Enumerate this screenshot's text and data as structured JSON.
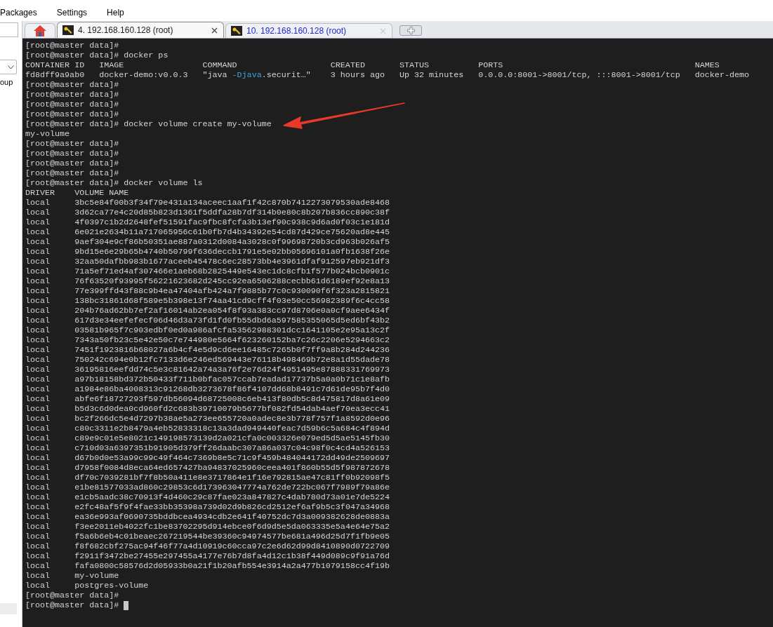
{
  "menu": [
    {
      "label": "Packages"
    },
    {
      "label": "Settings"
    },
    {
      "label": "Help"
    }
  ],
  "sidebar": {
    "partial_label": "oup"
  },
  "tabs": [
    {
      "kind": "home",
      "selected": false
    },
    {
      "kind": "session",
      "label": "4. 192.168.160.128 (root)",
      "selected": true
    },
    {
      "kind": "session",
      "label": "10. 192.168.160.128 (root)",
      "selected": false
    }
  ],
  "terminal": {
    "lines": [
      {
        "kind": "prompt",
        "prompt": "[root@master data]#",
        "cursor": false
      },
      {
        "kind": "prompt",
        "prompt": "[root@master data]#",
        "command": "docker ps",
        "cursor": false
      },
      {
        "kind": "ps",
        "cells": [
          [
            {
              "text": "CONTAINER ID"
            }
          ],
          [
            {
              "text": "IMAGE"
            }
          ],
          [
            {
              "text": "COMMAND"
            }
          ],
          [
            {
              "text": "CREATED"
            }
          ],
          [
            {
              "text": "STATUS"
            }
          ],
          [
            {
              "text": "PORTS"
            }
          ],
          [
            {
              "text": "NAMES"
            }
          ]
        ]
      },
      {
        "kind": "ps",
        "cells": [
          [
            {
              "text": "fd8dff9a9ab0"
            }
          ],
          [
            {
              "text": "docker-demo:v0.0.3"
            }
          ],
          [
            {
              "text": "\"java "
            },
            {
              "text": "-Djava",
              "color": "#3fa9d9"
            },
            {
              "text": ".securit…\""
            }
          ],
          [
            {
              "text": "3 hours ago"
            }
          ],
          [
            {
              "text": "Up 32 minutes"
            }
          ],
          [
            {
              "text": "0.0.0.0:8001->8001/tcp, :::8001->8001/tcp"
            }
          ],
          [
            {
              "text": "docker-demo"
            }
          ]
        ]
      },
      {
        "kind": "prompt",
        "prompt": "[root@master data]#",
        "cursor": false
      },
      {
        "kind": "prompt",
        "prompt": "[root@master data]#",
        "cursor": false
      },
      {
        "kind": "prompt",
        "prompt": "[root@master data]#",
        "cursor": false
      },
      {
        "kind": "prompt",
        "prompt": "[root@master data]#",
        "cursor": false
      },
      {
        "kind": "prompt",
        "prompt": "[root@master data]#",
        "command": "docker volume create my-volume",
        "cursor": false
      },
      {
        "kind": "output",
        "text": "my-volume"
      },
      {
        "kind": "prompt",
        "prompt": "[root@master data]#",
        "cursor": false
      },
      {
        "kind": "prompt",
        "prompt": "[root@master data]#",
        "cursor": false
      },
      {
        "kind": "prompt",
        "prompt": "[root@master data]#",
        "cursor": false
      },
      {
        "kind": "prompt",
        "prompt": "[root@master data]#",
        "cursor": false
      },
      {
        "kind": "prompt",
        "prompt": "[root@master data]#",
        "command": "docker volume ls",
        "cursor": false
      },
      {
        "kind": "volume",
        "driver": "DRIVER",
        "name": "VOLUME NAME"
      },
      {
        "kind": "volume",
        "driver": "local",
        "name": "3bc5e84f00b3f34f79e431a134aceec1aaf1f42c870b7412273079530ade8468"
      },
      {
        "kind": "volume",
        "driver": "local",
        "name": "3d62ca77e4c20d85b823d1361f5ddfa28b7df314b0e80c8b207b836cc890c38f"
      },
      {
        "kind": "volume",
        "driver": "local",
        "name": "4f0397c1b2d2648fef51591fac9fbc8fcfa3b13ef90c938c9d6ad0f03c1e181d"
      },
      {
        "kind": "volume",
        "driver": "local",
        "name": "6e021e2634b11a717065956c61b0fb7d4b34392e54cd87d429ce75620ad8e445"
      },
      {
        "kind": "volume",
        "driver": "local",
        "name": "9aef304e9cf86b50351ae887a0312d0084a3028c0f99698720b3cd963b026af5"
      },
      {
        "kind": "volume",
        "driver": "local",
        "name": "9bd15e6e29b65b4740b50799f636deccb1791e5e02bb05696101a0fb1638f26e"
      },
      {
        "kind": "volume",
        "driver": "local",
        "name": "32aa50dafbb983b1677aceeb45478c6ec28573bb4e3961dfaf912597eb921df3"
      },
      {
        "kind": "volume",
        "driver": "local",
        "name": "71a5ef71ed4af307466e1aeb68b2825449e543ec1dc8cfb1f577b024bcb0901c"
      },
      {
        "kind": "volume",
        "driver": "local",
        "name": "76f63520f93995f56221623682d245cc92ea6506288cecbb61d6189ef92e8a13"
      },
      {
        "kind": "volume",
        "driver": "local",
        "name": "77e399ffd43f88c9b4ea47404afb424a7f9885b77c0c930090f6f323a2815821"
      },
      {
        "kind": "volume",
        "driver": "local",
        "name": "138bc31861d68f589e5b398e13f74aa41cd9cff4f03e50cc56982389f6c4cc58"
      },
      {
        "kind": "volume",
        "driver": "local",
        "name": "204b76ad62bb7ef2af16014ab2ea054f8f93a383cc97d8706e0a0cf9aee6434f"
      },
      {
        "kind": "volume",
        "driver": "local",
        "name": "617d3e34eefefecf06d46d3a73fd1fd0fb55dbd6a597585355065d5ed6bf43b2"
      },
      {
        "kind": "volume",
        "driver": "local",
        "name": "03581b965f7c903edbf0ed0a986afcfa53562988301dcc1641105e2e95a13c2f"
      },
      {
        "kind": "volume",
        "driver": "local",
        "name": "7343a50fb23c5e42e50c7e744980e5664f623260152ba7c26c2206e5294663c2"
      },
      {
        "kind": "volume",
        "driver": "local",
        "name": "7451f1923816b68027a6b4cf4e5d9cd6ee16485c7265b0f7ff9a8b284d244236"
      },
      {
        "kind": "volume",
        "driver": "local",
        "name": "750242c694e0b12fc7133d6e246ed569443e76118b498469b72e8a1d55dade78"
      },
      {
        "kind": "volume",
        "driver": "local",
        "name": "36195816eefdd74c5e3c81642a74a3a76f2e76d24f4951495e87888331769973"
      },
      {
        "kind": "volume",
        "driver": "local",
        "name": "a97b18158bd372b50433f711b0bfac057ccab7eadad17737b5a0a0b71c1e8afb"
      },
      {
        "kind": "volume",
        "driver": "local",
        "name": "a1984e86ba4008313c91268db3273678f86f4107dd68b8491c7d61de95b7f4d0"
      },
      {
        "kind": "volume",
        "driver": "local",
        "name": "abfe6f18727293f597db56094d68725008c6eb413f80db5c8d475817d8a61e09"
      },
      {
        "kind": "volume",
        "driver": "local",
        "name": "b5d3c6d0dea0cd960fd2c683b39710079b5677bf082fd54dab4aef70ea3ecc41"
      },
      {
        "kind": "volume",
        "driver": "local",
        "name": "bc2f266dc5e4d7297b38ae5a273ee655720a0adec8e3b778f757f1a8592d0e96"
      },
      {
        "kind": "volume",
        "driver": "local",
        "name": "c80c3311e2b8479a4eb52833318c13a3dad949440feac7d59b6c5a684c4f894d"
      },
      {
        "kind": "volume",
        "driver": "local",
        "name": "c89e9c01e5e8021c149198573139d2a021cfa0c003326e079ed5d5ae5145fb30"
      },
      {
        "kind": "volume",
        "driver": "local",
        "name": "c710d03a6397351b91905d379ff26daabc307a86a037c04c98f0c4cd4a526153"
      },
      {
        "kind": "volume",
        "driver": "local",
        "name": "d67b0d0e53a99c99c49f464c7369b8e5c71c9f459b484044172dd49de2509697"
      },
      {
        "kind": "volume",
        "driver": "local",
        "name": "d7958f0084d8eca64ed657427ba94837025960ceea401f860b55d5f987872678"
      },
      {
        "kind": "volume",
        "driver": "local",
        "name": "df70c7039281bf7f8b50a411e8e3717864e1f16e792815ae47c81ff0b92098f5"
      },
      {
        "kind": "volume",
        "driver": "local",
        "name": "e1be81577033ad860c29853c6d173963047774a762de722bc067f7989f79a86e"
      },
      {
        "kind": "volume",
        "driver": "local",
        "name": "e1cb5aadc38c70913f4d460c29c87fae023a847827c4dab780d73a01e7de5224"
      },
      {
        "kind": "volume",
        "driver": "local",
        "name": "e2fc48af5f9f4fae33bb35398a739d02d9b826cd2512ef6af9b5c3f047a34968"
      },
      {
        "kind": "volume",
        "driver": "local",
        "name": "ea36e993af0690735bddbcea4934cdb2e641f40752dc7d3a009382628de0883a"
      },
      {
        "kind": "volume",
        "driver": "local",
        "name": "f3ee2011eb4022fc1be83702295d914ebce0f6d9d5e5da063335e5a4e64e75a2"
      },
      {
        "kind": "volume",
        "driver": "local",
        "name": "f5a6b6eb4c01beaec267219544be39360c94974577be681a496d25d7f1fb9e05"
      },
      {
        "kind": "volume",
        "driver": "local",
        "name": "f8f682cbf275ac94f46f77a4d10919c60cca97c2e6d62d99d8410890d0722709"
      },
      {
        "kind": "volume",
        "driver": "local",
        "name": "f2911f3472be27455e297455a4177e76b7d8fa4d12c1b38f449d089c9f91a76d"
      },
      {
        "kind": "volume",
        "driver": "local",
        "name": "fafa0800c58576d2d05933b0a21f1b20afb554e3914a2a477b1079158cc4f19b"
      },
      {
        "kind": "volume",
        "driver": "local",
        "name": "my-volume"
      },
      {
        "kind": "volume",
        "driver": "local",
        "name": "postgres-volume"
      },
      {
        "kind": "prompt",
        "prompt": "[root@master data]#",
        "cursor": false
      },
      {
        "kind": "prompt",
        "prompt": "[root@master data]#",
        "cursor": true
      }
    ]
  }
}
